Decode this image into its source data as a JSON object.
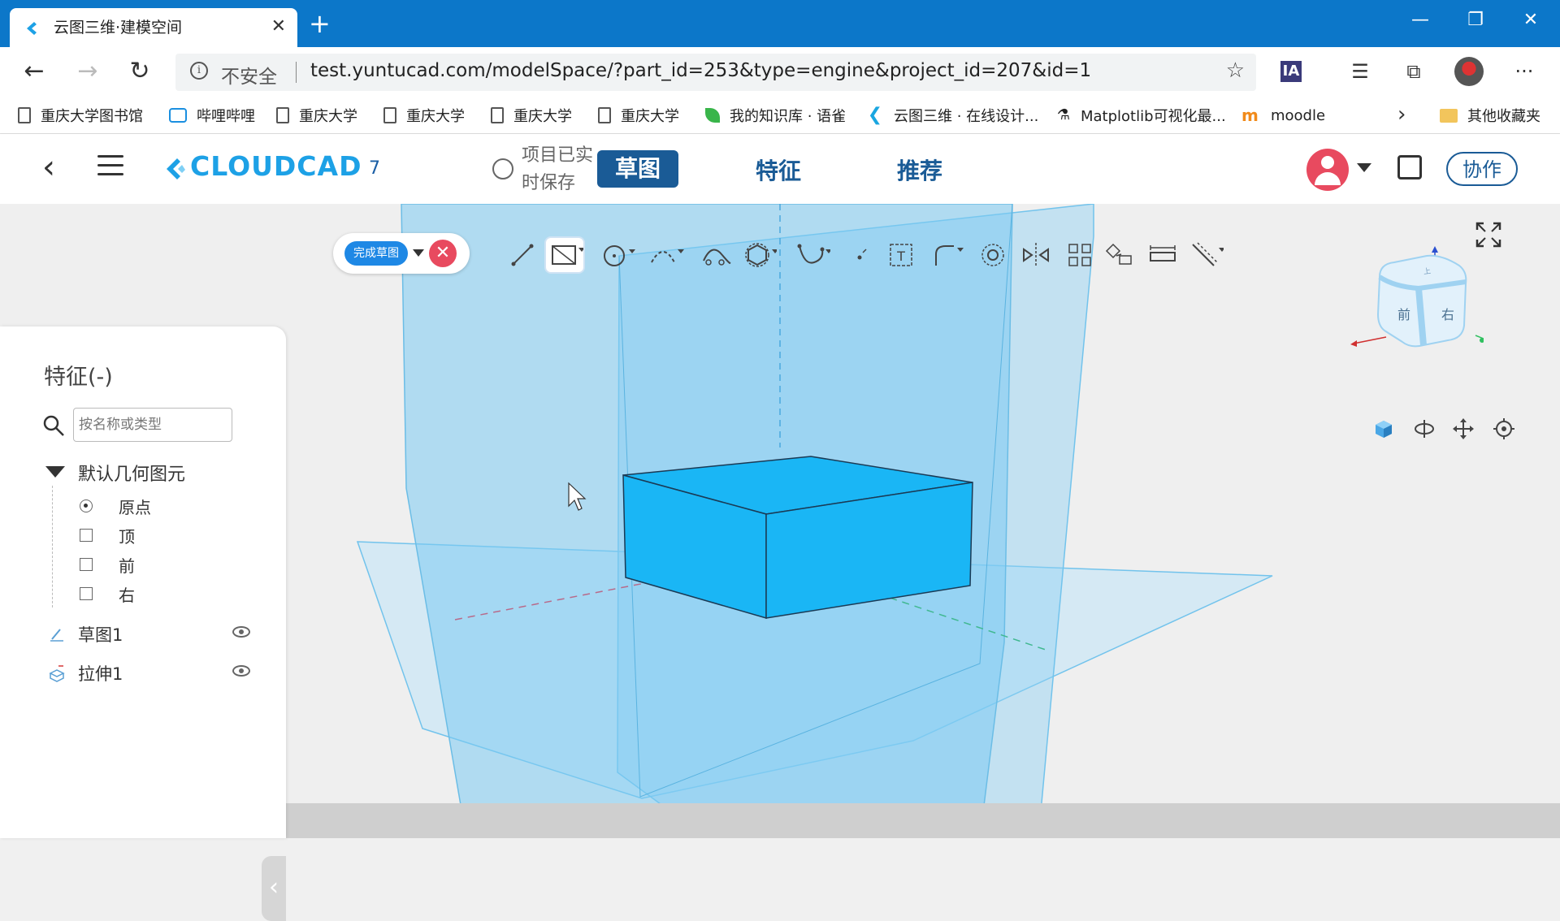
{
  "browser": {
    "tab_title": "云图三维·建模空间",
    "url": "test.yuntucad.com/modelSpace/?part_id=253&type=engine&project_id=207&id=1",
    "insecure_label": "不安全",
    "new_tab_glyph": "+",
    "close_glyph": "✕",
    "ia_badge": "IA",
    "bookmarks": [
      {
        "label": "重庆大学图书馆",
        "icon": "page-icon"
      },
      {
        "label": "哔哩哔哩",
        "icon": "bilibili-icon"
      },
      {
        "label": "重庆大学",
        "icon": "page-icon"
      },
      {
        "label": "重庆大学",
        "icon": "page-icon"
      },
      {
        "label": "重庆大学",
        "icon": "page-icon"
      },
      {
        "label": "重庆大学",
        "icon": "page-icon"
      },
      {
        "label": "我的知识库 · 语雀",
        "icon": "yuque-icon"
      },
      {
        "label": "云图三维 · 在线设计...",
        "icon": "cloudcad-icon"
      },
      {
        "label": "Matplotlib可视化最...",
        "icon": "matplotlib-icon"
      },
      {
        "label": "moodle",
        "icon": "moodle-icon"
      }
    ],
    "other_bookmarks": "其他收藏夹"
  },
  "app": {
    "logo_text": "CLOUDCAD",
    "project_number": "7",
    "save_status": "项目已实时保存",
    "tabs": [
      {
        "label": "草图",
        "active": true
      },
      {
        "label": "特征",
        "active": false
      },
      {
        "label": "推荐",
        "active": false
      }
    ],
    "collab_label": "协作",
    "brand_color": "#1da1e6",
    "accent_color": "#1a5b96"
  },
  "sketch_toolbar": {
    "finish_label": "完成草图",
    "tools": [
      "line-tool-icon",
      "rectangle-tool-icon",
      "circle-tool-icon",
      "arc-tool-icon",
      "trim-tool-icon",
      "polygon-tool-icon",
      "spline-tool-icon",
      "point-tool-icon",
      "text-tool-icon",
      "fillet-tool-icon",
      "offset-tool-icon",
      "mirror-tool-icon",
      "pattern-tool-icon",
      "transform-tool-icon",
      "dimension-tool-icon",
      "construction-tool-icon"
    ]
  },
  "nav_cube": {
    "front": "前",
    "right": "右",
    "top": "上"
  },
  "feature_panel": {
    "title": "特征(-)",
    "search_placeholder": "按名称或类型",
    "default_group": "默认几何图元",
    "default_items": [
      {
        "label": "原点",
        "icon": "origin-icon"
      },
      {
        "label": "顶",
        "icon": "plane-icon"
      },
      {
        "label": "前",
        "icon": "plane-icon"
      },
      {
        "label": "右",
        "icon": "plane-icon"
      }
    ],
    "features": [
      {
        "label": "草图1",
        "icon": "sketch-icon"
      },
      {
        "label": "拉伸1",
        "icon": "extrude-icon"
      }
    ]
  }
}
